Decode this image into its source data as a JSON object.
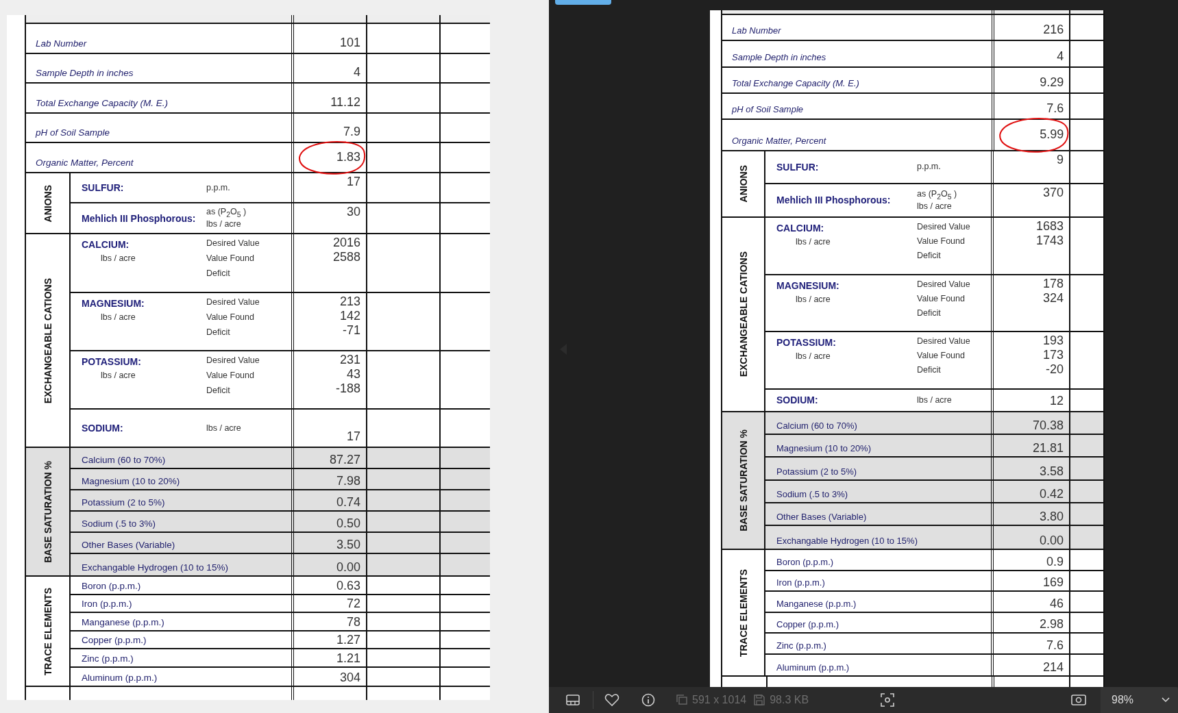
{
  "sheets": [
    {
      "basic": [
        {
          "label": "Lab Number",
          "value": "101",
          "circled": false
        },
        {
          "label": "Sample Depth in inches",
          "value": "4",
          "circled": false
        },
        {
          "label": "Total Exchange Capacity (M. E.)",
          "value": "11.12",
          "circled": false
        },
        {
          "label": "pH of Soil Sample",
          "value": "7.9",
          "circled": false
        },
        {
          "label": "Organic Matter, Percent",
          "value": "1.83",
          "circled": true
        }
      ],
      "sections": [
        {
          "kind": "anions",
          "title": "ANIONS",
          "shaded": false,
          "rows": [
            {
              "kind": "unit",
              "name": "SULFUR:",
              "unit": [
                "p.p.m."
              ],
              "values": [
                "17"
              ]
            },
            {
              "kind": "unit",
              "name": "Mehlich III Phosphorous:",
              "unit": [
                "as (P$_{2}$O$_{5}$ )",
                "lbs / acre"
              ],
              "values": [
                "30"
              ]
            }
          ]
        },
        {
          "kind": "cations",
          "title": "EXCHANGEABLE CATIONS",
          "shaded": false,
          "rows": [
            {
              "kind": "cation",
              "name": "CALCIUM:",
              "sub": "lbs / acre",
              "measures": [
                "Desired Value",
                "Value Found",
                "Deficit"
              ],
              "values": [
                "2016",
                "2588"
              ]
            },
            {
              "kind": "cation",
              "name": "MAGNESIUM:",
              "sub": "lbs / acre",
              "measures": [
                "Desired Value",
                "Value Found",
                "Deficit"
              ],
              "values": [
                "213",
                "142",
                "-71"
              ]
            },
            {
              "kind": "cation",
              "name": "POTASSIUM:",
              "sub": "lbs / acre",
              "measures": [
                "Desired Value",
                "Value Found",
                "Deficit"
              ],
              "values": [
                "231",
                "43",
                "-188"
              ]
            },
            {
              "kind": "unit",
              "name": "SODIUM:",
              "unit": [
                "lbs / acre"
              ],
              "values": [
                "17"
              ]
            }
          ]
        },
        {
          "kind": "base",
          "title": "BASE SATURATION %",
          "shaded": true,
          "rows": [
            {
              "kind": "simple",
              "label": "Calcium (60 to 70%)",
              "values": [
                "87.27"
              ]
            },
            {
              "kind": "simple",
              "label": "Magnesium (10 to 20%)",
              "values": [
                "7.98"
              ]
            },
            {
              "kind": "simple",
              "label": "Potassium (2 to 5%)",
              "values": [
                "0.74"
              ]
            },
            {
              "kind": "simple",
              "label": "Sodium (.5 to 3%)",
              "values": [
                "0.50"
              ]
            },
            {
              "kind": "simple",
              "label": "Other Bases (Variable)",
              "values": [
                "3.50"
              ]
            },
            {
              "kind": "simple",
              "label": "Exchangable Hydrogen (10 to 15%)",
              "values": [
                "0.00"
              ]
            }
          ]
        },
        {
          "kind": "trace",
          "title": "TRACE ELEMENTS",
          "shaded": false,
          "rows": [
            {
              "kind": "simple",
              "label": "Boron (p.p.m.)",
              "values": [
                "0.63"
              ]
            },
            {
              "kind": "simple",
              "label": "Iron (p.p.m.)",
              "values": [
                "72"
              ]
            },
            {
              "kind": "simple",
              "label": "Manganese (p.p.m.)",
              "values": [
                "78"
              ]
            },
            {
              "kind": "simple",
              "label": "Copper (p.p.m.)",
              "values": [
                "1.27"
              ]
            },
            {
              "kind": "simple",
              "label": "Zinc (p.p.m.)",
              "values": [
                "1.21"
              ]
            },
            {
              "kind": "simple",
              "label": "Aluminum (p.p.m.)",
              "values": [
                "304"
              ]
            }
          ]
        }
      ]
    },
    {
      "basic": [
        {
          "label": "Lab Number",
          "value": "216",
          "circled": false
        },
        {
          "label": "Sample Depth in inches",
          "value": "4",
          "circled": false
        },
        {
          "label": "Total Exchange Capacity (M. E.)",
          "value": "9.29",
          "circled": false
        },
        {
          "label": "pH of Soil Sample",
          "value": "7.6",
          "circled": false
        },
        {
          "label": "Organic Matter, Percent",
          "value": "5.99",
          "circled": true
        }
      ],
      "sections": [
        {
          "kind": "anions",
          "title": "ANIONS",
          "shaded": false,
          "rows": [
            {
              "kind": "unit",
              "name": "SULFUR:",
              "unit": [
                "p.p.m."
              ],
              "values": [
                "9"
              ]
            },
            {
              "kind": "unit",
              "name": "Mehlich III Phosphorous:",
              "unit": [
                "as (P$_{2}$O$_{5}$ )",
                "lbs / acre"
              ],
              "values": [
                "370"
              ]
            }
          ]
        },
        {
          "kind": "cations",
          "title": "EXCHANGEABLE CATIONS",
          "shaded": false,
          "rows": [
            {
              "kind": "cation",
              "name": "CALCIUM:",
              "sub": "lbs / acre",
              "measures": [
                "Desired Value",
                "Value Found",
                "Deficit"
              ],
              "values": [
                "1683",
                "1743"
              ]
            },
            {
              "kind": "cation",
              "name": "MAGNESIUM:",
              "sub": "lbs / acre",
              "measures": [
                "Desired Value",
                "Value Found",
                "Deficit"
              ],
              "values": [
                "178",
                "324"
              ]
            },
            {
              "kind": "cation",
              "name": "POTASSIUM:",
              "sub": "lbs / acre",
              "measures": [
                "Desired Value",
                "Value Found",
                "Deficit"
              ],
              "values": [
                "193",
                "173",
                "-20"
              ]
            },
            {
              "kind": "unit",
              "name": "SODIUM:",
              "unit": [
                "lbs / acre"
              ],
              "values": [
                "12"
              ]
            }
          ]
        },
        {
          "kind": "base",
          "title": "BASE SATURATION %",
          "shaded": true,
          "rows": [
            {
              "kind": "simple",
              "label": "Calcium (60 to 70%)",
              "values": [
                "70.38"
              ]
            },
            {
              "kind": "simple",
              "label": "Magnesium (10 to 20%)",
              "values": [
                "21.81"
              ]
            },
            {
              "kind": "simple",
              "label": "Potassium (2 to 5%)",
              "values": [
                "3.58"
              ]
            },
            {
              "kind": "simple",
              "label": "Sodium (.5 to 3%)",
              "values": [
                "0.42"
              ]
            },
            {
              "kind": "simple",
              "label": "Other Bases (Variable)",
              "values": [
                "3.80"
              ]
            },
            {
              "kind": "simple",
              "label": "Exchangable Hydrogen (10 to 15%)",
              "values": [
                "0.00"
              ]
            }
          ]
        },
        {
          "kind": "trace",
          "title": "TRACE ELEMENTS",
          "shaded": false,
          "rows": [
            {
              "kind": "simple",
              "label": "Boron (p.p.m.)",
              "values": [
                "0.9"
              ]
            },
            {
              "kind": "simple",
              "label": "Iron (p.p.m.)",
              "values": [
                "169"
              ]
            },
            {
              "kind": "simple",
              "label": "Manganese (p.p.m.)",
              "values": [
                "46"
              ]
            },
            {
              "kind": "simple",
              "label": "Copper (p.p.m.)",
              "values": [
                "2.98"
              ]
            },
            {
              "kind": "simple",
              "label": "Zinc (p.p.m.)",
              "values": [
                "7.6"
              ]
            },
            {
              "kind": "simple",
              "label": "Aluminum (p.p.m.)",
              "values": [
                "214"
              ]
            }
          ]
        }
      ]
    }
  ],
  "viewer_toolbar": {
    "dimensions": "591 x 1014",
    "file_size": "98.3 KB",
    "zoom": "98%"
  }
}
